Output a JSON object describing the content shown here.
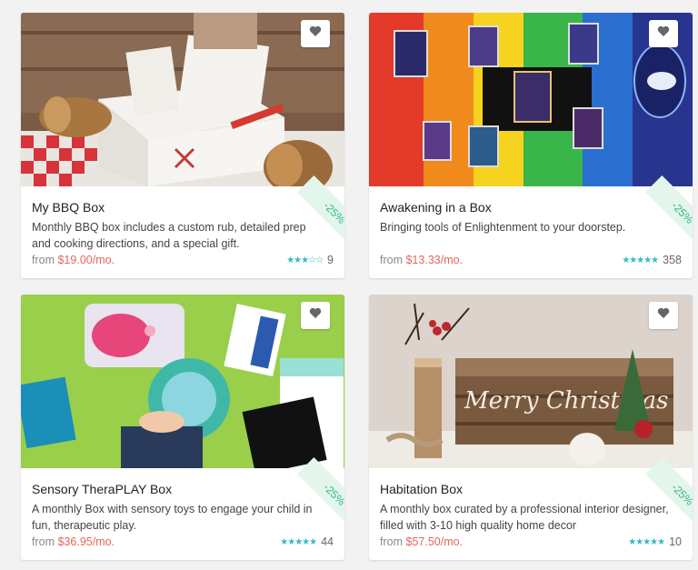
{
  "cards": [
    {
      "title": "My BBQ Box",
      "description": "Monthly BBQ box includes a custom rub, detailed prep and cooking directions, and a special gift.",
      "from_label": "from",
      "price": "$19.00",
      "per": "/mo.",
      "discount": "-25%",
      "stars": "★★★☆☆",
      "review_count": "9",
      "rating_fraction": 0.7
    },
    {
      "title": "Awakening in a Box",
      "description": "Bringing tools of Enlightenment to your doorstep.",
      "from_label": "from",
      "price": "$13.33",
      "per": "/mo.",
      "discount": "-25%",
      "stars": "★★★★★",
      "review_count": "358",
      "rating_fraction": 0.9
    },
    {
      "title": "Sensory TheraPLAY Box",
      "description": "A monthly Box with sensory toys to engage your child in fun, therapeutic play.",
      "from_label": "from",
      "price": "$36.95",
      "per": "/mo.",
      "discount": "-25%",
      "stars": "★★★★★",
      "review_count": "44",
      "rating_fraction": 0.9
    },
    {
      "title": "Habitation Box",
      "description": "A monthly box curated by a professional interior designer, filled with 3-10 high quality home decor",
      "from_label": "from",
      "price": "$57.50",
      "per": "/mo.",
      "discount": "-25%",
      "stars": "★★★★★",
      "review_count": "10",
      "rating_fraction": 1.0
    }
  ],
  "colors": {
    "price": "#e8655a",
    "stars": "#35b8c9",
    "discount": "#35b48a"
  }
}
